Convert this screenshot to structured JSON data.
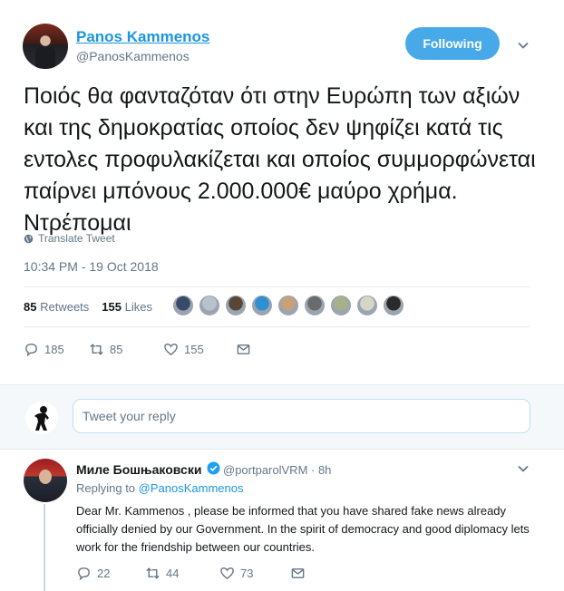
{
  "tweet": {
    "author_name": "Panos Kammenos",
    "author_handle": "@PanosKammenos",
    "follow_label": "Following",
    "text": "Ποιός θα φανταζόταν ότι στην Ευρώπη των αξιών και της δημοκρατίας οποίος δεν ψηφίζει κατά τις εντολες προφυλακίζεται και οποίος συμμορφώνεται παίρνει μπόνους 2.000.000€ μαύρο χρήμα. Ντρέπομαι",
    "translate_label": "Translate Tweet",
    "timestamp": "10:34 PM - 19 Oct 2018",
    "retweets_count": "85",
    "retweets_label": "Retweets",
    "likes_count": "155",
    "likes_label": "Likes",
    "liker_avatar_colors": [
      "#3a4a6b",
      "#b9c2cc",
      "#5a4636",
      "#2f8fd0",
      "#c8a07a",
      "#6b6b6b",
      "#a7b08a",
      "#d6d6c8",
      "#2b2b2b"
    ],
    "actions": {
      "replies": "185",
      "retweets": "85",
      "likes": "155"
    }
  },
  "reply_box": {
    "placeholder": "Tweet your reply"
  },
  "reply": {
    "author_name": "Миле Бошњаковски",
    "author_handle": "@portparolVRM · 8h",
    "replying_prefix": "Replying to",
    "replying_handle": "@PanosKammenos",
    "text": "Dear Mr. Kammenos , please be informed that you have shared fake news already officially denied by our Government. In the spirit of democracy and good diplomacy lets work for the friendship between our countries.",
    "actions": {
      "replies": "22",
      "retweets": "44",
      "likes": "73"
    }
  },
  "colors": {
    "accent": "#1b95e0",
    "follow_bg": "#47a9e8",
    "muted": "#657786"
  }
}
